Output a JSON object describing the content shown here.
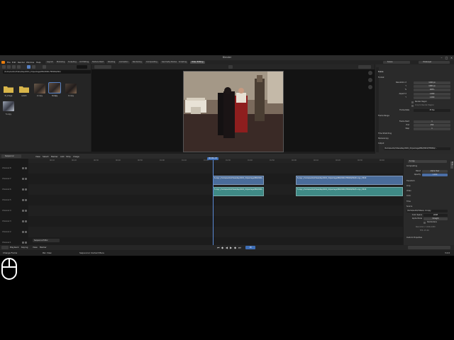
{
  "window": {
    "title": "Blender"
  },
  "menu": [
    "File",
    "Edit",
    "Render",
    "Window",
    "Help"
  ],
  "workspaces": [
    "Layout",
    "Modeling",
    "Sculpting",
    "UV Editing",
    "Texture Paint",
    "Shading",
    "Animation",
    "Rendering",
    "Compositing",
    "Geometry Nodes",
    "Scripting",
    "Video Editing"
  ],
  "scene": {
    "label": "Scene",
    "view_layer": "ViewLayer"
  },
  "file_browser": {
    "path": "/home/audio/Videos/bsp/2021_01/package/M02/0001/TP0094/020/",
    "items": [
      {
        "name": "M_image",
        "kind": "folder"
      },
      {
        "name": "subdir",
        "kind": "folder"
      },
      {
        "name": "2.copy",
        "kind": "image"
      },
      {
        "name": "3.copy",
        "kind": "image"
      },
      {
        "name": "4.copy",
        "kind": "image"
      },
      {
        "name": "5.copy",
        "kind": "image"
      }
    ]
  },
  "properties": {
    "panel_title": "Scene",
    "format_header": "Format",
    "rows": [
      {
        "label": "Resolution X",
        "value": "1440 px"
      },
      {
        "label": "Y",
        "value": "1080 px"
      },
      {
        "label": "%",
        "value": "100%"
      },
      {
        "label": "Aspect X",
        "value": "1.000"
      },
      {
        "label": "Y",
        "value": "1.000"
      }
    ],
    "render_region": "Render Region",
    "crop": "Crop to Render Region",
    "frame_rate_label": "Frame Rate",
    "frame_rate": "25 fps",
    "frame_range_header": "Frame Range",
    "frame_start_label": "Frame Start",
    "frame_start": "1",
    "end_label": "End",
    "end": "250",
    "step_label": "Step",
    "step": "1",
    "time_stretch": "Time Stretching",
    "stereo": "Stereoscopy",
    "output_header": "Output",
    "output_path": "/home/audio/Videos/bsp/2021_01/package/M02/0001/TP0094/..."
  },
  "sequencer": {
    "header_label": "Sequencer",
    "menus": [
      "View",
      "Select",
      "Marker",
      "Add",
      "Strip",
      "Image"
    ],
    "current_frame": "00:00+18",
    "ruler_ticks": [
      "00:10",
      "00:20",
      "00:30",
      "00:40",
      "00:50",
      "01:00",
      "01:10",
      "01:20",
      "01:30",
      "01:40",
      "01:50",
      "02:00",
      "02:10",
      "02:20",
      "02:30",
      "02:40"
    ],
    "channels": [
      "Channel 8",
      "Channel 7",
      "Channel 6",
      "Channel 5",
      "Channel 4",
      "Channel 3",
      "Channel 2",
      "Channel 1"
    ],
    "strips": [
      {
        "text": "6.copy | /home/audio/Videos/bsp/2021_01/package/M02/0001/TP0094/020/6.copy | 8100",
        "kind": "blue",
        "channel": "Channel 6"
      },
      {
        "text": "6.copy | /home/audio/Videos/bsp/2021_01/package/M02/0001/TP0094/020/6.copy | 8100",
        "kind": "blue",
        "channel": "Channel 6"
      },
      {
        "text": "5.copy | /home/audio/Videos/bsp/2021_01/package/M02/0001/TP0094/020/5.copy | 8100",
        "kind": "teal",
        "channel": "Channel 5"
      },
      {
        "text": "5.copy | /home/audio/Videos/bsp/2021_01/package/M02/0001/TP0094/020/5.copy | 8100",
        "kind": "teal",
        "channel": "Channel 5"
      }
    ],
    "footer_label": "Sequence Editor"
  },
  "strip_panel": {
    "tab": "Strip",
    "title": "6.copy",
    "compositing": "Compositing",
    "blend_label": "Blend",
    "blend": "Alpha Over",
    "opacity_label": "Opacity",
    "opacity": "1.000",
    "transform": "Transform",
    "crop": "Crop",
    "video": "Video",
    "color": "Color",
    "time": "Time",
    "source": "Source",
    "source_path": "/home/audio/Videos/...6.copy",
    "color_space_label": "Color Space",
    "color_space": "sRGB",
    "alpha_label": "Alpha Mode",
    "alpha": "Straight",
    "deinterlace": "Deinterlace",
    "resolution": "Resolution: 1440x1080",
    "fps": "FPS: 25.00",
    "custom_props": "Custom Properties"
  },
  "timeline": {
    "playback": "Playback",
    "keying": "Keying",
    "view": "View",
    "marker": "Marker",
    "frame": "18"
  },
  "status": {
    "left": "Change Frame",
    "mid": "Pan View",
    "right": "Sequencer Context Menu",
    "version": "3.0.0"
  },
  "colors": {
    "blue_strip": "#4a6c9a",
    "teal_strip": "#3f8a86",
    "playhead": "#5a8ad6",
    "accent": "#3f6fb7"
  }
}
